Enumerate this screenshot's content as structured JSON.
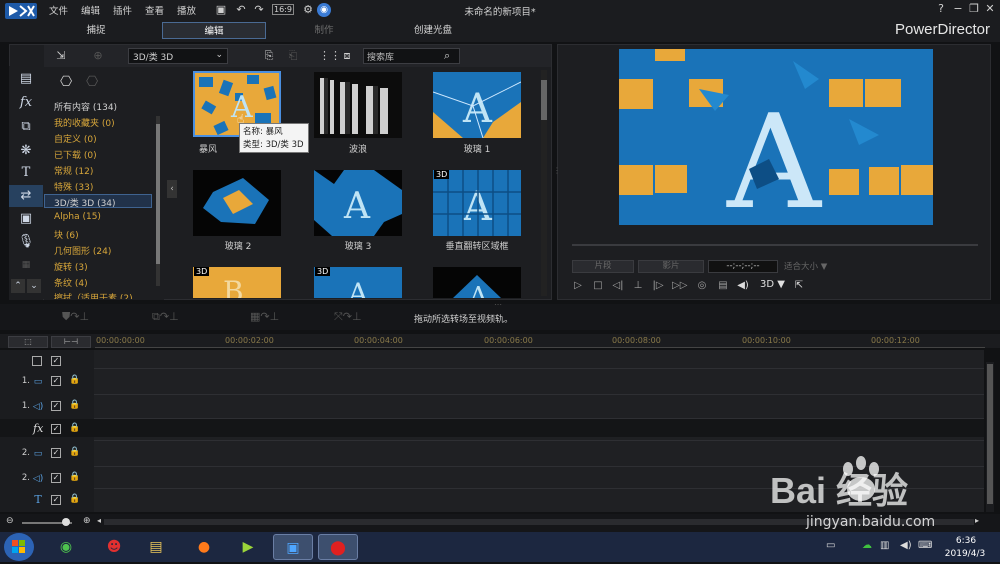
{
  "menu": [
    "文件",
    "编辑",
    "插件",
    "查看",
    "播放"
  ],
  "window_title": "未命名的新项目*",
  "mode_tabs": [
    "捕捉",
    "编辑",
    "制作",
    "创建光盘"
  ],
  "brand": "PowerDirector",
  "library": {
    "category_selected": "3D/类 3D",
    "search_placeholder": "搜索库",
    "categories": [
      "所有内容 (134)",
      "我的收藏夹  (0)",
      "自定义  (0)",
      "已下载  (0)",
      "常规  (12)",
      "特殊  (33)",
      "3D/类 3D  (34)",
      "Alpha  (15)",
      "块  (6)",
      "几何图形  (24)",
      "旋转  (3)",
      "条纹  (4)",
      "擦拭（适用于素  (2)"
    ],
    "items": [
      "暴风",
      "波浪",
      "玻璃 1",
      "玻璃 2",
      "玻璃 3",
      "垂直翻转区域框",
      "",
      "",
      ""
    ],
    "badge_3d": "3D",
    "tooltip": {
      "name": "名称: 暴风",
      "type": "类型: 3D/类 3D"
    }
  },
  "preview": {
    "btn_clip": "片段",
    "btn_movie": "影片",
    "timecode": "--;--;--;--",
    "viewsize": "适合大小 ▼",
    "mode3d": "3D ▼"
  },
  "edit_hint": "拖动所选转场至视频轨。",
  "timeline": {
    "ruler": [
      "00:00:00:00",
      "00:00:02:00",
      "00:00:04:00",
      "00:00:06:00",
      "00:00:08:00",
      "00:00:10:00",
      "00:00:12:00"
    ],
    "tracks": [
      "1.",
      "1.",
      "2.",
      "2."
    ]
  },
  "taskbar": {
    "time": "6:36",
    "date": "2019/4/3"
  },
  "watermark": {
    "text": "Bai 经验",
    "url": "jingyan.baidu.com"
  },
  "colors": {
    "accent": "#3f6390",
    "category": "#d7a63a",
    "video_blue": "#1a73b8",
    "video_orange": "#e8a83a"
  }
}
